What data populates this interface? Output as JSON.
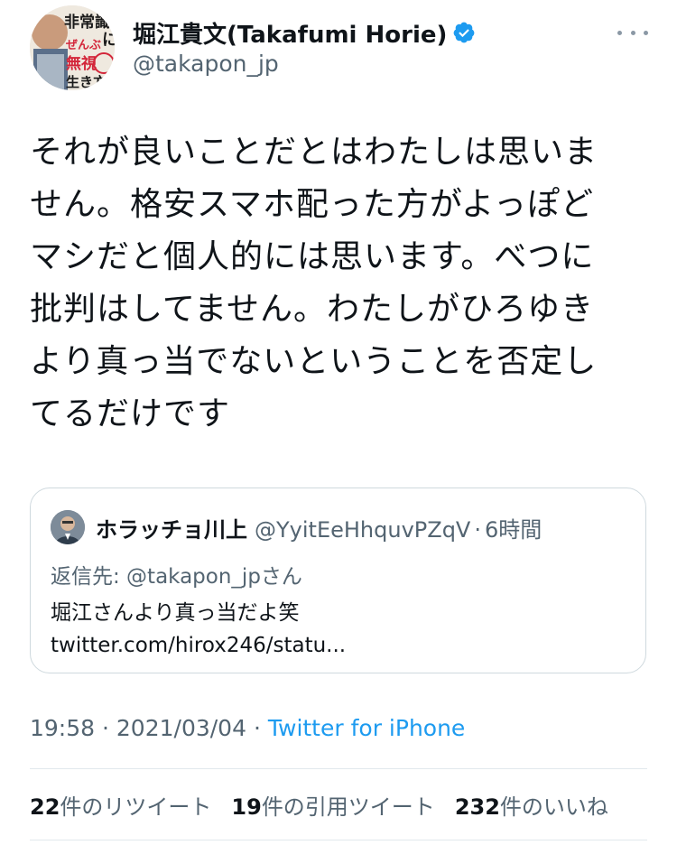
{
  "author": {
    "display_name": "堀江貴文(Takafumi Horie)",
    "handle": "@takapon_jp",
    "avatar_text": [
      "非常識",
      "ぜんぶ",
      "無視",
      "生き方",
      "に"
    ]
  },
  "tweet": {
    "text": "それが良いことだとはわたしは思いま\nせん。格安スマホ配った方がよっぽど\nマシだと個人的には思います。べつに\n批判はしてません。わたしがひろゆき\nより真っ当でないということを否定し\nてるだけです"
  },
  "quote": {
    "name": "ホラッチョ川上",
    "handle": "@YyitEeHhquvPZqV",
    "separator": "·",
    "time": "6時間",
    "reply_to": "返信先: @takapon_jpさん",
    "text": "堀江さんより真っ当だよ笑\ntwitter.com/hirox246/statu..."
  },
  "meta": {
    "time": "19:58",
    "date": "2021/03/04",
    "separator": "·",
    "source": "Twitter for iPhone"
  },
  "stats": {
    "retweets_count": "22",
    "retweets_label": "件のリツイート",
    "quotes_count": "19",
    "quotes_label": "件の引用ツイート",
    "likes_count": "232",
    "likes_label": "件のいいね"
  },
  "colors": {
    "link": "#1d9bf0",
    "secondary": "#536471",
    "verified": "#1d9bf0",
    "avatar_text_red": "#d3263a"
  }
}
